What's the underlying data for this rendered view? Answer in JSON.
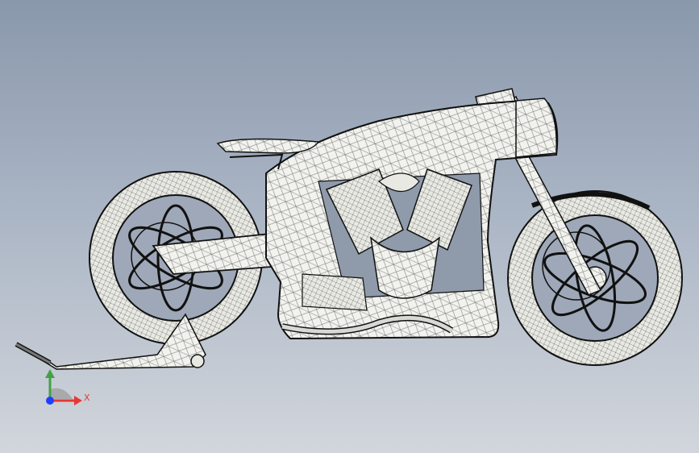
{
  "viewport": {
    "background_top": "#8a98ac",
    "background_bottom": "#d2d6dc",
    "model_fill": "#f2f2ee",
    "mesh_stroke": "#1a1a1a"
  },
  "triad": {
    "x_label": "X",
    "x_color": "#e53935",
    "y_color": "#43a047",
    "z_color": "#1e40ff"
  }
}
